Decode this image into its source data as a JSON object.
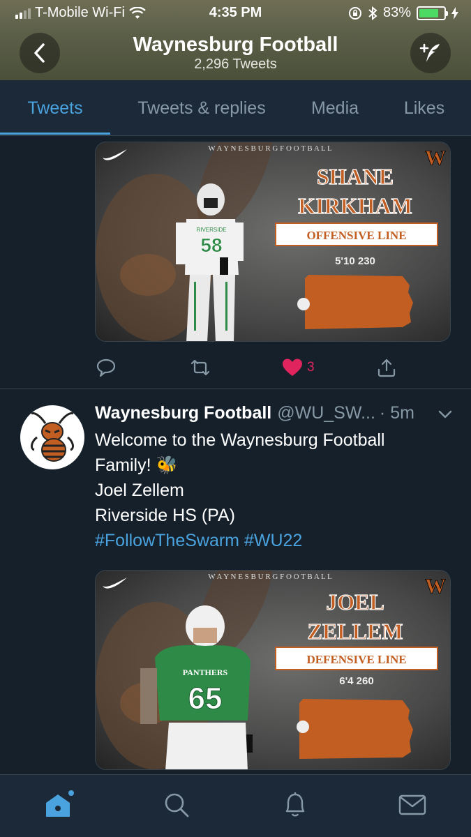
{
  "status_bar": {
    "carrier": "T-Mobile Wi-Fi",
    "time": "4:35 PM",
    "battery": "83%"
  },
  "header": {
    "title": "Waynesburg Football",
    "subtitle": "2,296 Tweets"
  },
  "tabs": [
    {
      "label": "Tweets",
      "active": true
    },
    {
      "label": "Tweets & replies",
      "active": false
    },
    {
      "label": "Media",
      "active": false
    },
    {
      "label": "Likes",
      "active": false
    }
  ],
  "tweet1": {
    "card": {
      "banner": "W A Y N E S B U R G   F O O T B A L L",
      "logo": "W",
      "first_name": "SHANE",
      "last_name": "KIRKHAM",
      "position": "OFFENSIVE LINE",
      "measurements": "5'10  230",
      "jersey": "58",
      "team": "RIVERSIDE"
    },
    "like_count": "3"
  },
  "tweet2": {
    "name": "Waynesburg Football",
    "handle": "@WU_SW...",
    "time": "· 5m",
    "line1": "Welcome to the Waynesburg Football",
    "line2": "Family! 🐝",
    "line3": "Joel Zellem",
    "line4": "Riverside HS (PA)",
    "hashtags": "#FollowTheSwarm #WU22",
    "card": {
      "banner": "W A Y N E S B U R G   F O O T B A L L",
      "logo": "W",
      "first_name": "JOEL",
      "last_name": "ZELLEM",
      "position": "DEFENSIVE LINE",
      "measurements": "6'4 260",
      "jersey": "65",
      "team": "PANTHERS"
    }
  },
  "colors": {
    "accent": "#4aa3df",
    "like": "#e0245e",
    "background": "#15202b",
    "card_orange": "#c25e22"
  }
}
